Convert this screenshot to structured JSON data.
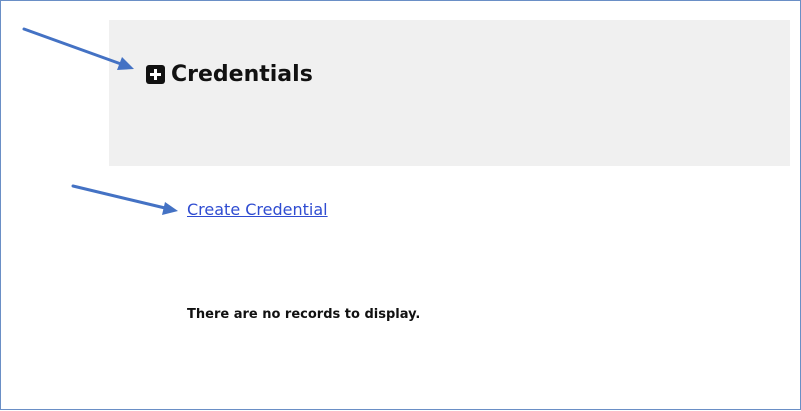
{
  "section": {
    "title": "Credentials",
    "expand_icon": "plus-square-icon"
  },
  "actions": {
    "create_label": "Create Credential"
  },
  "table": {
    "empty_message": "There are no records to display."
  },
  "colors": {
    "link": "#2f4cd1",
    "header_panel": "#f0f0f0",
    "annotation_arrow": "#4472c4",
    "frame_border": "#6a8fc6"
  }
}
